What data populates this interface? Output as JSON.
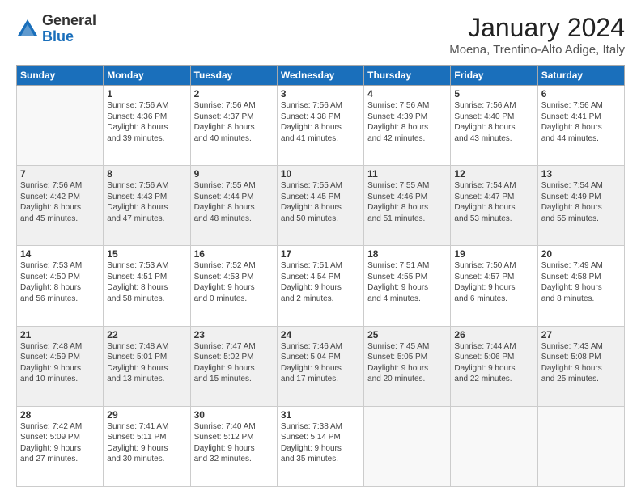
{
  "logo": {
    "general": "General",
    "blue": "Blue"
  },
  "title": "January 2024",
  "location": "Moena, Trentino-Alto Adige, Italy",
  "weekdays": [
    "Sunday",
    "Monday",
    "Tuesday",
    "Wednesday",
    "Thursday",
    "Friday",
    "Saturday"
  ],
  "weeks": [
    [
      {
        "day": "",
        "info": ""
      },
      {
        "day": "1",
        "info": "Sunrise: 7:56 AM\nSunset: 4:36 PM\nDaylight: 8 hours\nand 39 minutes."
      },
      {
        "day": "2",
        "info": "Sunrise: 7:56 AM\nSunset: 4:37 PM\nDaylight: 8 hours\nand 40 minutes."
      },
      {
        "day": "3",
        "info": "Sunrise: 7:56 AM\nSunset: 4:38 PM\nDaylight: 8 hours\nand 41 minutes."
      },
      {
        "day": "4",
        "info": "Sunrise: 7:56 AM\nSunset: 4:39 PM\nDaylight: 8 hours\nand 42 minutes."
      },
      {
        "day": "5",
        "info": "Sunrise: 7:56 AM\nSunset: 4:40 PM\nDaylight: 8 hours\nand 43 minutes."
      },
      {
        "day": "6",
        "info": "Sunrise: 7:56 AM\nSunset: 4:41 PM\nDaylight: 8 hours\nand 44 minutes."
      }
    ],
    [
      {
        "day": "7",
        "info": "Sunrise: 7:56 AM\nSunset: 4:42 PM\nDaylight: 8 hours\nand 45 minutes."
      },
      {
        "day": "8",
        "info": "Sunrise: 7:56 AM\nSunset: 4:43 PM\nDaylight: 8 hours\nand 47 minutes."
      },
      {
        "day": "9",
        "info": "Sunrise: 7:55 AM\nSunset: 4:44 PM\nDaylight: 8 hours\nand 48 minutes."
      },
      {
        "day": "10",
        "info": "Sunrise: 7:55 AM\nSunset: 4:45 PM\nDaylight: 8 hours\nand 50 minutes."
      },
      {
        "day": "11",
        "info": "Sunrise: 7:55 AM\nSunset: 4:46 PM\nDaylight: 8 hours\nand 51 minutes."
      },
      {
        "day": "12",
        "info": "Sunrise: 7:54 AM\nSunset: 4:47 PM\nDaylight: 8 hours\nand 53 minutes."
      },
      {
        "day": "13",
        "info": "Sunrise: 7:54 AM\nSunset: 4:49 PM\nDaylight: 8 hours\nand 55 minutes."
      }
    ],
    [
      {
        "day": "14",
        "info": "Sunrise: 7:53 AM\nSunset: 4:50 PM\nDaylight: 8 hours\nand 56 minutes."
      },
      {
        "day": "15",
        "info": "Sunrise: 7:53 AM\nSunset: 4:51 PM\nDaylight: 8 hours\nand 58 minutes."
      },
      {
        "day": "16",
        "info": "Sunrise: 7:52 AM\nSunset: 4:53 PM\nDaylight: 9 hours\nand 0 minutes."
      },
      {
        "day": "17",
        "info": "Sunrise: 7:51 AM\nSunset: 4:54 PM\nDaylight: 9 hours\nand 2 minutes."
      },
      {
        "day": "18",
        "info": "Sunrise: 7:51 AM\nSunset: 4:55 PM\nDaylight: 9 hours\nand 4 minutes."
      },
      {
        "day": "19",
        "info": "Sunrise: 7:50 AM\nSunset: 4:57 PM\nDaylight: 9 hours\nand 6 minutes."
      },
      {
        "day": "20",
        "info": "Sunrise: 7:49 AM\nSunset: 4:58 PM\nDaylight: 9 hours\nand 8 minutes."
      }
    ],
    [
      {
        "day": "21",
        "info": "Sunrise: 7:48 AM\nSunset: 4:59 PM\nDaylight: 9 hours\nand 10 minutes."
      },
      {
        "day": "22",
        "info": "Sunrise: 7:48 AM\nSunset: 5:01 PM\nDaylight: 9 hours\nand 13 minutes."
      },
      {
        "day": "23",
        "info": "Sunrise: 7:47 AM\nSunset: 5:02 PM\nDaylight: 9 hours\nand 15 minutes."
      },
      {
        "day": "24",
        "info": "Sunrise: 7:46 AM\nSunset: 5:04 PM\nDaylight: 9 hours\nand 17 minutes."
      },
      {
        "day": "25",
        "info": "Sunrise: 7:45 AM\nSunset: 5:05 PM\nDaylight: 9 hours\nand 20 minutes."
      },
      {
        "day": "26",
        "info": "Sunrise: 7:44 AM\nSunset: 5:06 PM\nDaylight: 9 hours\nand 22 minutes."
      },
      {
        "day": "27",
        "info": "Sunrise: 7:43 AM\nSunset: 5:08 PM\nDaylight: 9 hours\nand 25 minutes."
      }
    ],
    [
      {
        "day": "28",
        "info": "Sunrise: 7:42 AM\nSunset: 5:09 PM\nDaylight: 9 hours\nand 27 minutes."
      },
      {
        "day": "29",
        "info": "Sunrise: 7:41 AM\nSunset: 5:11 PM\nDaylight: 9 hours\nand 30 minutes."
      },
      {
        "day": "30",
        "info": "Sunrise: 7:40 AM\nSunset: 5:12 PM\nDaylight: 9 hours\nand 32 minutes."
      },
      {
        "day": "31",
        "info": "Sunrise: 7:38 AM\nSunset: 5:14 PM\nDaylight: 9 hours\nand 35 minutes."
      },
      {
        "day": "",
        "info": ""
      },
      {
        "day": "",
        "info": ""
      },
      {
        "day": "",
        "info": ""
      }
    ]
  ]
}
